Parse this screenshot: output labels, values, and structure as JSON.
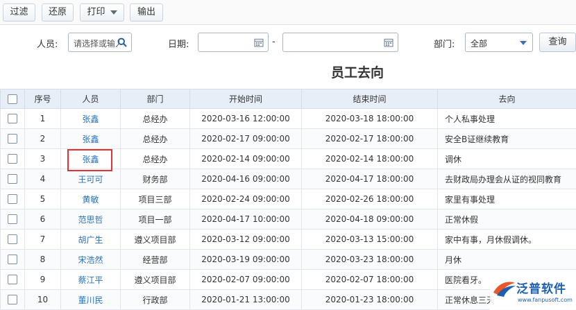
{
  "toolbar": {
    "filter_label": "过滤",
    "restore_label": "还原",
    "print_label": "打印",
    "export_label": "输出"
  },
  "filters": {
    "person_label": "人员:",
    "person_placeholder": "请选择或输入",
    "date_label": "日期:",
    "date_from": "",
    "date_separator": "-",
    "date_to": "",
    "dept_label": "部门:",
    "dept_value": "全部",
    "query_label": "查询"
  },
  "report": {
    "title": "员工去向"
  },
  "table": {
    "headers": {
      "index": "序号",
      "person": "人员",
      "dept": "部门",
      "start": "开始时间",
      "end": "结束时间",
      "dest": "去向"
    },
    "rows": [
      {
        "index": "1",
        "person": "张鑫",
        "dept": "总经办",
        "start": "2020-03-16 12:00:00",
        "end": "2020-03-18 18:00:00",
        "dest": "个人私事处理"
      },
      {
        "index": "2",
        "person": "张鑫",
        "dept": "总经办",
        "start": "2020-02-17 09:00:00",
        "end": "2020-02-17 18:00:00",
        "dest": "安全B证继续教育"
      },
      {
        "index": "3",
        "person": "张鑫",
        "dept": "总经办",
        "start": "2020-02-14 09:00:00",
        "end": "2020-02-14 18:00:00",
        "dest": "调休"
      },
      {
        "index": "4",
        "person": "王可可",
        "dept": "财务部",
        "start": "2020-04-16 09:00:00",
        "end": "2020-04-17 18:00:00",
        "dest": "去财政局办理会从证的视同教育"
      },
      {
        "index": "5",
        "person": "黄敏",
        "dept": "项目三部",
        "start": "2020-02-24 09:00:00",
        "end": "2020-02-26 18:00:00",
        "dest": "家里有事处理"
      },
      {
        "index": "6",
        "person": "范思哲",
        "dept": "项目一部",
        "start": "2020-04-17 10:00:00",
        "end": "2020-04-18 09:00:00",
        "dest": "正常休假"
      },
      {
        "index": "7",
        "person": "胡广生",
        "dept": "遵义项目部",
        "start": "2020-03-12 09:00:00",
        "end": "2020-03-13 15:00:00",
        "dest": "家中有事，月休假调休。"
      },
      {
        "index": "8",
        "person": "宋浩然",
        "dept": "经营部",
        "start": "2020-03-19 09:00:00",
        "end": "2020-03-23 18:00:00",
        "dest": "月休"
      },
      {
        "index": "9",
        "person": "蔡江平",
        "dept": "遵义项目部",
        "start": "2020-02-07 09:00:00",
        "end": "2020-02-07 18:00:00",
        "dest": "医院看牙。"
      },
      {
        "index": "10",
        "person": "董川民",
        "dept": "行政部",
        "start": "2020-01-21 13:00:00",
        "end": "2020-01-23 18:00:00",
        "dest": "正常休息三天"
      }
    ]
  },
  "watermark": {
    "brand": "泛普软件",
    "url": "www.fanpusoft.com"
  },
  "colors": {
    "link": "#2e72b8",
    "header_bg": "#e8eef7",
    "highlight": "#e03434",
    "brand": "#1c5fb0"
  }
}
